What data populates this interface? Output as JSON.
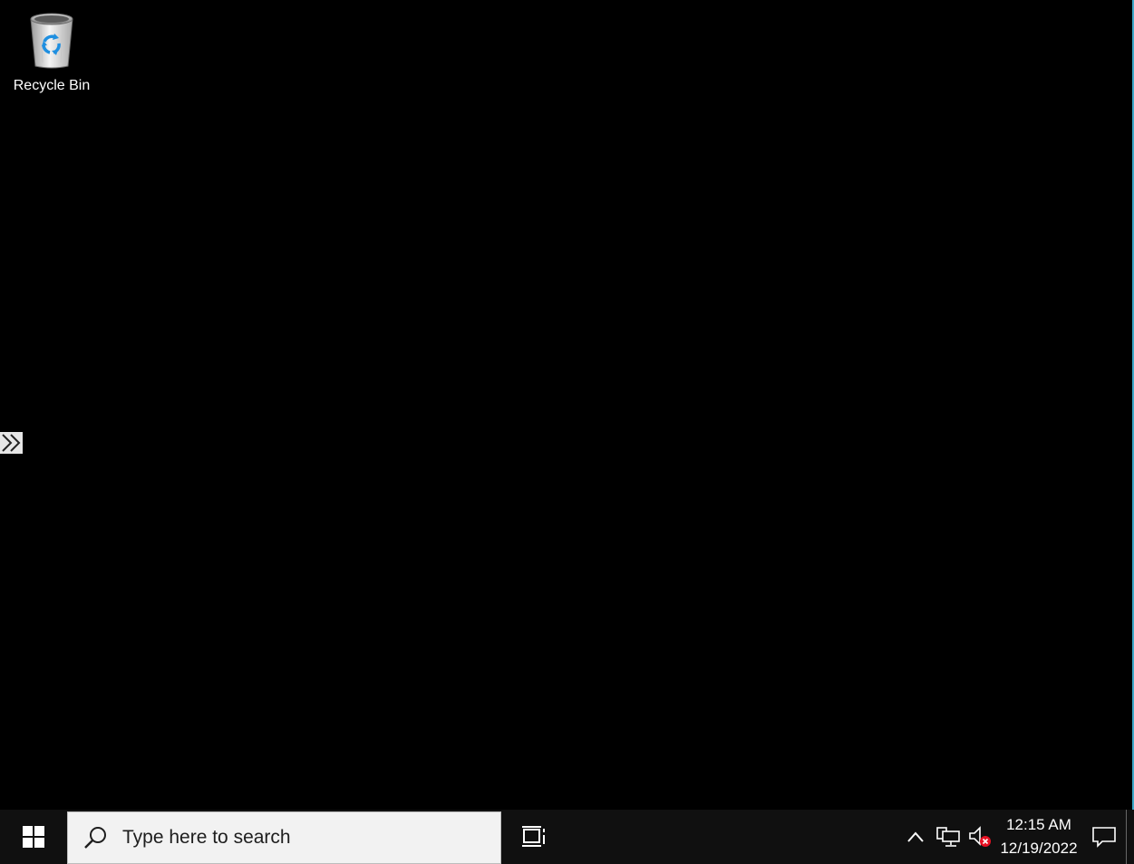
{
  "desktop": {
    "icons": [
      {
        "label": "Recycle Bin",
        "icon": "recycle-bin-icon"
      }
    ]
  },
  "side_expander": {
    "icon": "double-chevron-right-icon"
  },
  "taskbar": {
    "start_icon": "windows-logo-icon",
    "search": {
      "placeholder": "Type here to search",
      "value": "",
      "icon": "search-icon"
    },
    "task_view_icon": "task-view-icon",
    "tray": {
      "overflow_icon": "chevron-up-icon",
      "network_icon": "network-wired-icon",
      "volume_icon": "volume-muted-icon",
      "clock": {
        "time": "12:15 AM",
        "date": "12/19/2022"
      },
      "notification_icon": "action-center-icon"
    }
  },
  "colors": {
    "desktop_bg": "#000000",
    "taskbar_bg": "#101010",
    "search_bg": "#f2f2f2",
    "accent_border": "#3fa9c9",
    "mute_badge": "#e81123",
    "recycle_arrows": "#1f8fe0"
  }
}
